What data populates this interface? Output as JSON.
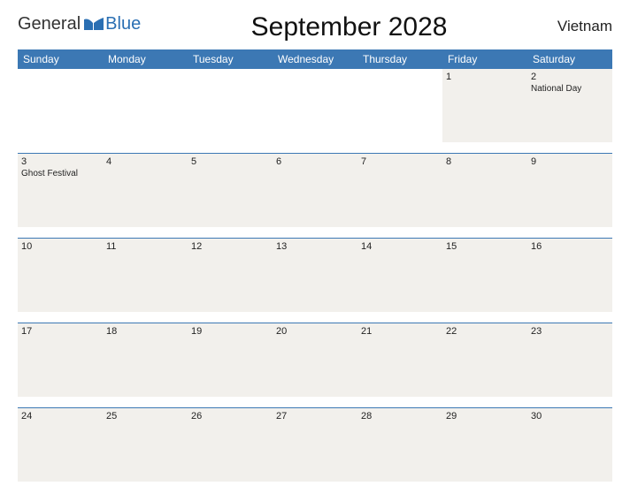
{
  "logo": {
    "text1": "General",
    "text2": "Blue"
  },
  "title": "September 2028",
  "country": "Vietnam",
  "daynames": [
    "Sunday",
    "Monday",
    "Tuesday",
    "Wednesday",
    "Thursday",
    "Friday",
    "Saturday"
  ],
  "weeks": [
    [
      {
        "n": "",
        "e": ""
      },
      {
        "n": "",
        "e": ""
      },
      {
        "n": "",
        "e": ""
      },
      {
        "n": "",
        "e": ""
      },
      {
        "n": "",
        "e": ""
      },
      {
        "n": "1",
        "e": ""
      },
      {
        "n": "2",
        "e": "National Day"
      }
    ],
    [
      {
        "n": "3",
        "e": "Ghost Festival"
      },
      {
        "n": "4",
        "e": ""
      },
      {
        "n": "5",
        "e": ""
      },
      {
        "n": "6",
        "e": ""
      },
      {
        "n": "7",
        "e": ""
      },
      {
        "n": "8",
        "e": ""
      },
      {
        "n": "9",
        "e": ""
      }
    ],
    [
      {
        "n": "10",
        "e": ""
      },
      {
        "n": "11",
        "e": ""
      },
      {
        "n": "12",
        "e": ""
      },
      {
        "n": "13",
        "e": ""
      },
      {
        "n": "14",
        "e": ""
      },
      {
        "n": "15",
        "e": ""
      },
      {
        "n": "16",
        "e": ""
      }
    ],
    [
      {
        "n": "17",
        "e": ""
      },
      {
        "n": "18",
        "e": ""
      },
      {
        "n": "19",
        "e": ""
      },
      {
        "n": "20",
        "e": ""
      },
      {
        "n": "21",
        "e": ""
      },
      {
        "n": "22",
        "e": ""
      },
      {
        "n": "23",
        "e": ""
      }
    ],
    [
      {
        "n": "24",
        "e": ""
      },
      {
        "n": "25",
        "e": ""
      },
      {
        "n": "26",
        "e": ""
      },
      {
        "n": "27",
        "e": ""
      },
      {
        "n": "28",
        "e": ""
      },
      {
        "n": "29",
        "e": ""
      },
      {
        "n": "30",
        "e": ""
      }
    ]
  ]
}
